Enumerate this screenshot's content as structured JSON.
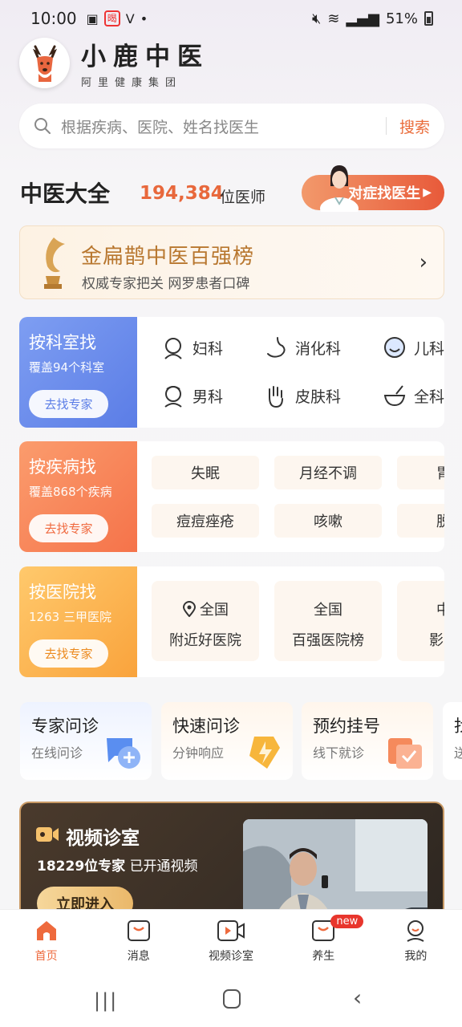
{
  "status": {
    "time": "10:00",
    "battery": "51%",
    "badge_text": "暍"
  },
  "header": {
    "brand": "小鹿中医",
    "subtitle": "阿里健康集团"
  },
  "search": {
    "placeholder": "根据疾病、医院、姓名找医生",
    "button": "搜索"
  },
  "overview": {
    "title": "中医大全",
    "count": "194,384",
    "count_unit": "位医师",
    "cta": "对症找医生"
  },
  "banner": {
    "title": "金扁鹊中医百强榜",
    "subtitle": "权威专家把关 网罗患者口碑"
  },
  "by_dept": {
    "title": "按科室找",
    "desc": "覆盖94个科室",
    "button": "去找专家",
    "items": [
      {
        "label": "妇科",
        "icon": "female-icon"
      },
      {
        "label": "消化科",
        "icon": "stomach-icon"
      },
      {
        "label": "儿科",
        "icon": "child-icon"
      },
      {
        "label": "男科",
        "icon": "male-icon"
      },
      {
        "label": "皮肤科",
        "icon": "hand-icon"
      },
      {
        "label": "全科",
        "icon": "mortar-icon"
      }
    ]
  },
  "by_disease": {
    "title": "按疾病找",
    "desc": "覆盖868个疾病",
    "button": "去找专家",
    "items": [
      "失眠",
      "月经不调",
      "胃炎",
      "痘痘痤疮",
      "咳嗽",
      "脱发"
    ]
  },
  "by_hospital": {
    "title": "按医院找",
    "desc": "1263 三甲医院",
    "button": "去找专家",
    "items": [
      {
        "line1": "全国",
        "line2": "附近好医院"
      },
      {
        "line1": "全国",
        "line2": "百强医院榜"
      },
      {
        "line1": "中医",
        "line2": "影响力"
      }
    ]
  },
  "services": [
    {
      "title": "专家问诊",
      "sub": "在线问诊"
    },
    {
      "title": "快速问诊",
      "sub": "分钟响应"
    },
    {
      "title": "预约挂号",
      "sub": "线下就诊"
    },
    {
      "title": "找药",
      "sub": "送药"
    }
  ],
  "video": {
    "title": "视频诊室",
    "experts": "18229位专家",
    "experts_suffix": "已开通视频",
    "button": "立即进入"
  },
  "tabs": [
    {
      "label": "首页",
      "icon": "home-icon"
    },
    {
      "label": "消息",
      "icon": "message-icon"
    },
    {
      "label": "视频诊室",
      "icon": "video-icon"
    },
    {
      "label": "养生",
      "icon": "wellness-icon",
      "badge": "new"
    },
    {
      "label": "我的",
      "icon": "profile-icon"
    }
  ],
  "colors": {
    "accent": "#ee6a3d",
    "dept_blue": "#5b7de6",
    "disease_orange": "#f5734a",
    "hospital_yellow": "#f9a33c"
  }
}
